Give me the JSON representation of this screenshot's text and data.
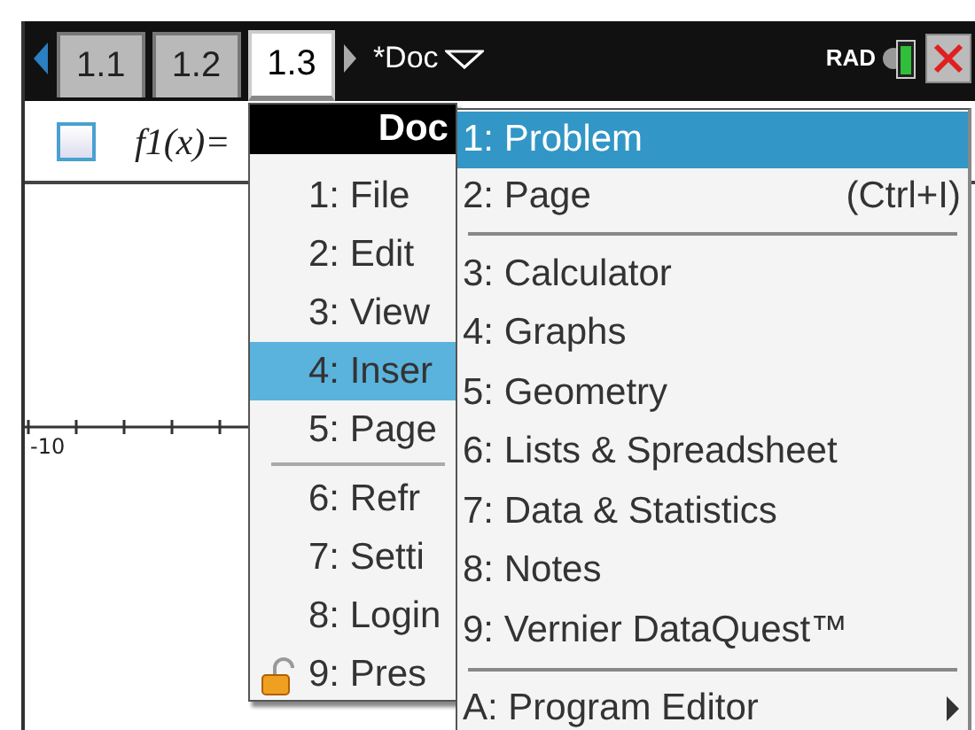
{
  "header": {
    "tabs": [
      {
        "label": "1.1",
        "selected": false
      },
      {
        "label": "1.2",
        "selected": false
      },
      {
        "label": "1.3",
        "selected": true
      }
    ],
    "document": "*Doc",
    "mode": "RAD"
  },
  "function_entry": {
    "checked": false,
    "label": "f1(x)="
  },
  "graph": {
    "axis_label": "-10"
  },
  "doc_menu": {
    "title": "Doc",
    "groups": [
      [
        {
          "label": "1: File",
          "selected": false,
          "locked": false
        },
        {
          "label": "2: Edit",
          "selected": false,
          "locked": false
        },
        {
          "label": "3: View",
          "selected": false,
          "locked": false
        },
        {
          "label": "4: Inser",
          "selected": true,
          "locked": false
        },
        {
          "label": "5: Page",
          "selected": false,
          "locked": false
        }
      ],
      [
        {
          "label": "6: Refr",
          "selected": false,
          "locked": false
        },
        {
          "label": "7: Setti",
          "selected": false,
          "locked": false
        },
        {
          "label": "8: Login",
          "selected": false,
          "locked": false
        },
        {
          "label": "9: Pres",
          "selected": false,
          "locked": true
        }
      ]
    ]
  },
  "insert_menu": {
    "groups": [
      [
        {
          "label": "1: Problem",
          "selected": true,
          "submenu": false
        },
        {
          "label": "2: Page",
          "shortcut": "(Ctrl+I)",
          "selected": false,
          "submenu": false
        }
      ],
      [
        {
          "label": "3: Calculator",
          "selected": false,
          "submenu": false
        },
        {
          "label": "4: Graphs",
          "selected": false,
          "submenu": false
        },
        {
          "label": "5: Geometry",
          "selected": false,
          "submenu": false
        },
        {
          "label": "6: Lists & Spreadsheet",
          "selected": false,
          "submenu": false
        },
        {
          "label": "7: Data & Statistics",
          "selected": false,
          "submenu": false
        },
        {
          "label": "8: Notes",
          "selected": false,
          "submenu": false
        },
        {
          "label": "9: Vernier DataQuest™",
          "selected": false,
          "submenu": false
        }
      ],
      [
        {
          "label": "A: Program Editor",
          "selected": false,
          "submenu": true
        }
      ]
    ]
  }
}
